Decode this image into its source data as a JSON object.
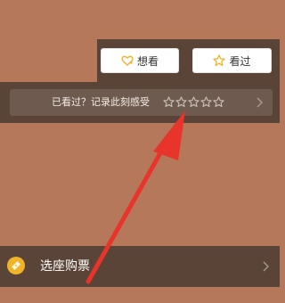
{
  "actions": {
    "want_label": "想看",
    "seen_label": "看过"
  },
  "rating": {
    "prompt": "已看过？记录此刻感受",
    "stars_total": 5,
    "stars_filled": 0
  },
  "purchase": {
    "label": "选座购票"
  },
  "icons": {
    "want": "heart-plus-icon",
    "seen": "star-icon",
    "rating_star": "star-outline-icon",
    "chevron": "chevron-right-icon",
    "ticket": "ticket-icon"
  },
  "colors": {
    "background": "#b5785a",
    "panel": "#5a4437",
    "gold": "#f0b429",
    "annotation": "#e8342a"
  }
}
